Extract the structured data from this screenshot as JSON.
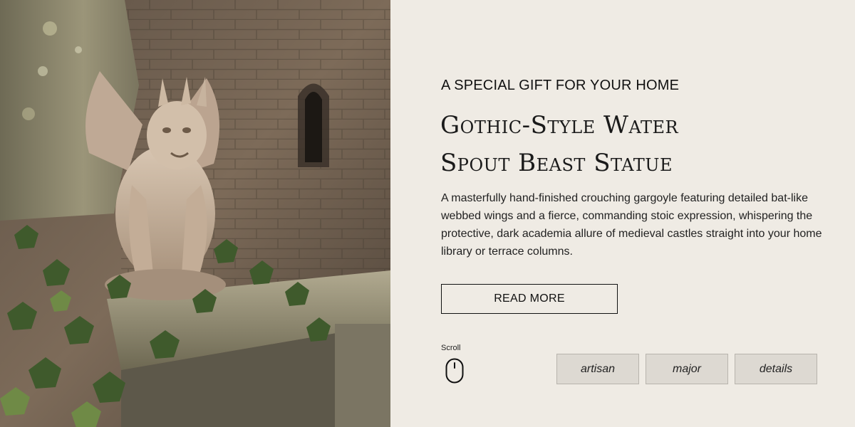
{
  "hero": {
    "image_subject": "stone-gargoyle-photo"
  },
  "content": {
    "kicker": "A SPECIAL GIFT FOR YOUR HOME",
    "title_lines": [
      "Gothic-Style Water",
      "Spout Beast Statue"
    ],
    "description": "A masterfully hand-finished crouching gargoyle featuring detailed bat-like webbed wings and a fierce, commanding stoic expression, whispering the protective, dark academia allure of medieval castles straight into your home library or terrace columns.",
    "read_more_label": "READ MORE",
    "scroll_label": "Scroll",
    "tags": [
      "artisan",
      "major",
      "details"
    ]
  },
  "colors": {
    "panel_background": "#efebe4",
    "tag_background": "#ddd9d2",
    "text": "#111111"
  },
  "icons": {
    "scroll": "mouse-icon"
  }
}
